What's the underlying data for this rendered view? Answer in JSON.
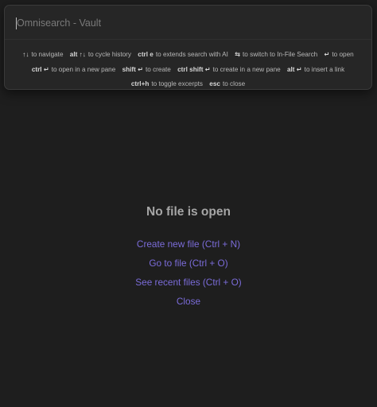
{
  "search": {
    "placeholder": "Omnisearch - Vault"
  },
  "instructions": [
    {
      "key": "↑↓",
      "label": "to navigate"
    },
    {
      "key": "alt ↑↓",
      "label": "to cycle history"
    },
    {
      "key": "ctrl e",
      "label": "to extends search with AI"
    },
    {
      "key": "⇆",
      "label": "to switch to In-File Search"
    },
    {
      "key": "↵",
      "label": "to open"
    },
    {
      "key": "ctrl ↵",
      "label": "to open in a new pane"
    },
    {
      "key": "shift ↵",
      "label": "to create"
    },
    {
      "key": "ctrl shift ↵",
      "label": "to create in a new pane"
    },
    {
      "key": "alt ↵",
      "label": "to insert a link"
    },
    {
      "key": "ctrl+h",
      "label": "to toggle excerpts"
    },
    {
      "key": "esc",
      "label": "to close"
    }
  ],
  "empty_state": {
    "title": "No file is open",
    "actions": {
      "create": "Create new file (Ctrl + N)",
      "goto": "Go to file (Ctrl + O)",
      "recent": "See recent files (Ctrl + O)",
      "close": "Close"
    }
  },
  "colors": {
    "background": "#1e1e1e",
    "modal": "#262626",
    "accent_link": "#7b6cd9"
  }
}
